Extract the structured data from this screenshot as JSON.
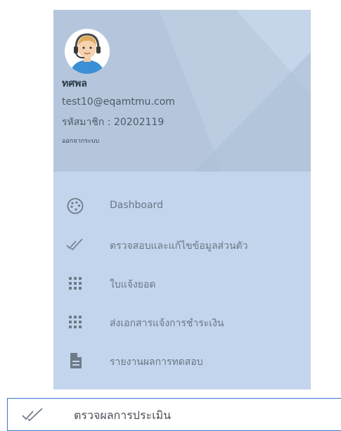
{
  "profile": {
    "name": "ทศพล",
    "email": "test10@eqamtmu.com",
    "member_label": "รหัสมาชิก : ",
    "member_id": "20202119",
    "logout": "ออกจากระบบ",
    "avatar_icon": "support-agent-avatar"
  },
  "menu": {
    "items": [
      {
        "label": "Dashboard",
        "icon": "palette-icon"
      },
      {
        "label": "ตรวจสอบและแก้ไขข้อมูลส่วนตัว",
        "icon": "double-check-icon"
      },
      {
        "label": "ใบแจ้งยอด",
        "icon": "grid-icon"
      },
      {
        "label": "ส่งเอกสารแจ้งการชำระเงิน",
        "icon": "grid-icon"
      },
      {
        "label": "รายงานผลการทดสอบ",
        "icon": "document-icon"
      }
    ]
  },
  "popup": {
    "label": "ตรวจผลการประเมิน",
    "icon": "double-check-icon"
  },
  "colors": {
    "sidebar_bg": "#c3d5ec",
    "profile_bg": "#b5c6dc",
    "popup_border": "#3a78c9"
  }
}
